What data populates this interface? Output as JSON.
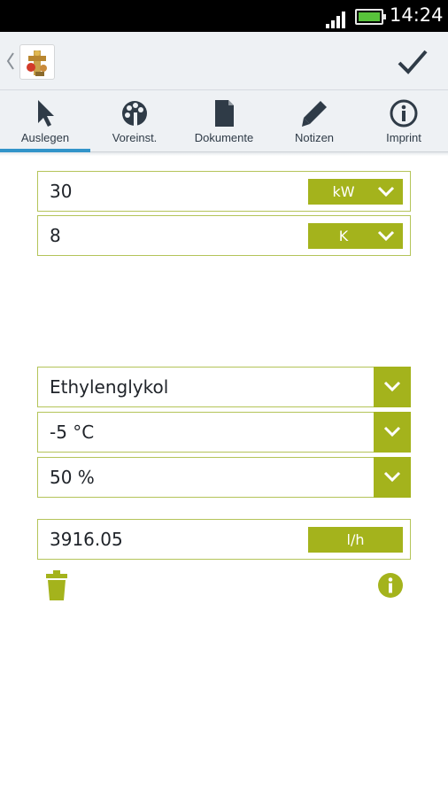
{
  "status_bar": {
    "time": "14:24",
    "icons": [
      "signal-icon",
      "battery-icon"
    ]
  },
  "action_bar": {
    "icons": [
      "back-chevron-icon",
      "app-logo",
      "checkmark-icon"
    ]
  },
  "tabs": [
    {
      "label": "Auslegen",
      "icon": "cursor-arrow-icon",
      "active": true
    },
    {
      "label": "Voreinst.",
      "icon": "palette-icon",
      "active": false
    },
    {
      "label": "Dokumente",
      "icon": "document-icon",
      "active": false
    },
    {
      "label": "Notizen",
      "icon": "pencil-icon",
      "active": false
    },
    {
      "label": "Imprint",
      "icon": "info-icon",
      "active": false
    }
  ],
  "inputs": {
    "power": {
      "value": "30",
      "unit": "kW"
    },
    "temp_diff": {
      "value": "8",
      "unit": "K"
    }
  },
  "fluid": {
    "medium": "Ethylenglykol",
    "temperature": "-5 °C",
    "concentration": "50 %"
  },
  "result": {
    "value": "3916.05",
    "unit": "l/h"
  },
  "colors": {
    "accent_green": "#a4b31c",
    "border_green": "#b4c459",
    "tab_underline": "#3294c9",
    "bar_bg": "#eef1f4",
    "icon_dark": "#2f3b47"
  }
}
